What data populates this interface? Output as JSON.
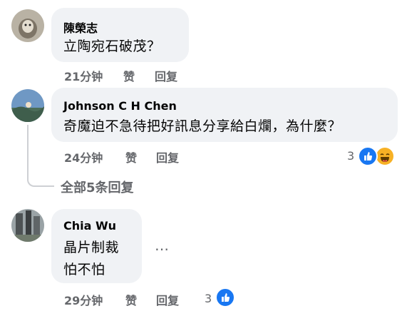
{
  "comments": [
    {
      "author": "陳榮志",
      "text_lines": [
        "立陶宛石破茂？"
      ],
      "time": "21分钟",
      "like_label": "赞",
      "reply_label": "回复"
    },
    {
      "author": "Johnson C H Chen",
      "text_lines": [
        "奇魔迫不急待把好訊息分享給白爛，為什麼？"
      ],
      "time": "24分钟",
      "like_label": "赞",
      "reply_label": "回复",
      "reaction_count": "3"
    },
    {
      "author": "Chia Wu",
      "text_lines": [
        "晶片制裁",
        "怕不怕"
      ],
      "time": "29分钟",
      "like_label": "赞",
      "reply_label": "回复",
      "reaction_count": "3",
      "more_label": "…"
    }
  ],
  "view_replies": "全部5条回复",
  "colors": {
    "bubble": "#f0f2f5",
    "meta": "#65676b",
    "like": "#1877f2",
    "haha": "#f7b125"
  },
  "icons": [
    "like-reaction-icon",
    "haha-reaction-icon",
    "more-options-icon"
  ]
}
